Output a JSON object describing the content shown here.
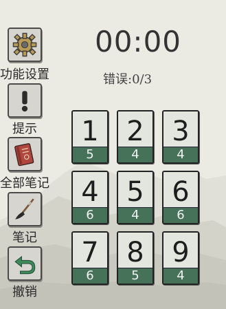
{
  "timer": "00:00",
  "mistakes": "错误:0/3",
  "sidebar": {
    "settings": "功能设置",
    "hint": "提示",
    "all_notes": "全部笔记",
    "notes": "笔记",
    "undo": "撤销"
  },
  "tiles": [
    {
      "number": "1",
      "count": "5"
    },
    {
      "number": "2",
      "count": "4"
    },
    {
      "number": "3",
      "count": "4"
    },
    {
      "number": "4",
      "count": "6"
    },
    {
      "number": "5",
      "count": "4"
    },
    {
      "number": "6",
      "count": "6"
    },
    {
      "number": "7",
      "count": "6"
    },
    {
      "number": "8",
      "count": "5"
    },
    {
      "number": "9",
      "count": "4"
    }
  ],
  "colors": {
    "background": "#ebebe4",
    "tile_bottom": "#47725a",
    "accent_red": "#b0473e"
  },
  "icons": [
    "gear-icon",
    "exclamation-icon",
    "notebook-icon",
    "brush-icon",
    "undo-arrow-icon"
  ]
}
